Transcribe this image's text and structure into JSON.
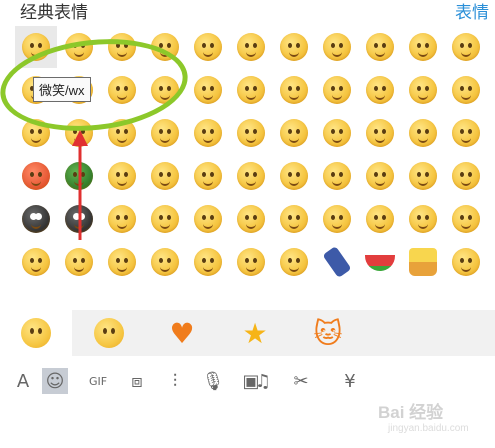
{
  "header": {
    "title": "经典表情",
    "manage_link": "表情"
  },
  "tooltip": "微笑/wx",
  "grid": {
    "rows": 6,
    "cols": 11,
    "selected_index": 0,
    "special": {
      "34": "green",
      "33": "red",
      "44": "dark",
      "45": "dark",
      "62": "book",
      "63": "melon",
      "64": "basket"
    }
  },
  "tabs": [
    {
      "icon": "smiley-face-icon",
      "active": true
    },
    {
      "icon": "grinning-face-icon",
      "active": false
    },
    {
      "icon": "heart-icon",
      "active": false
    },
    {
      "icon": "star-icon",
      "active": false
    },
    {
      "icon": "cat-icon",
      "active": false
    }
  ],
  "toolbar": [
    {
      "icon": "font-icon",
      "glyph": "A"
    },
    {
      "icon": "emoji-icon",
      "glyph": "☺",
      "active": true
    },
    {
      "icon": "gif-icon",
      "glyph": "GIF"
    },
    {
      "icon": "screenshot-icon",
      "glyph": "⧈"
    },
    {
      "icon": "shake-icon",
      "glyph": "⫶"
    },
    {
      "icon": "microphone-icon",
      "glyph": "🎙"
    },
    {
      "icon": "image-icon",
      "glyph": "▣"
    },
    {
      "icon": "music-icon",
      "glyph": "♫"
    },
    {
      "icon": "scissors-icon",
      "glyph": "✂"
    },
    {
      "icon": "red-packet-icon",
      "glyph": "¥"
    }
  ],
  "watermark": {
    "main": "Bai 经验",
    "sub": "jingyan.baidu.com"
  },
  "colors": {
    "accent_link": "#2a8fd8",
    "callout": "#8cc82a",
    "arrow": "#e03030"
  }
}
